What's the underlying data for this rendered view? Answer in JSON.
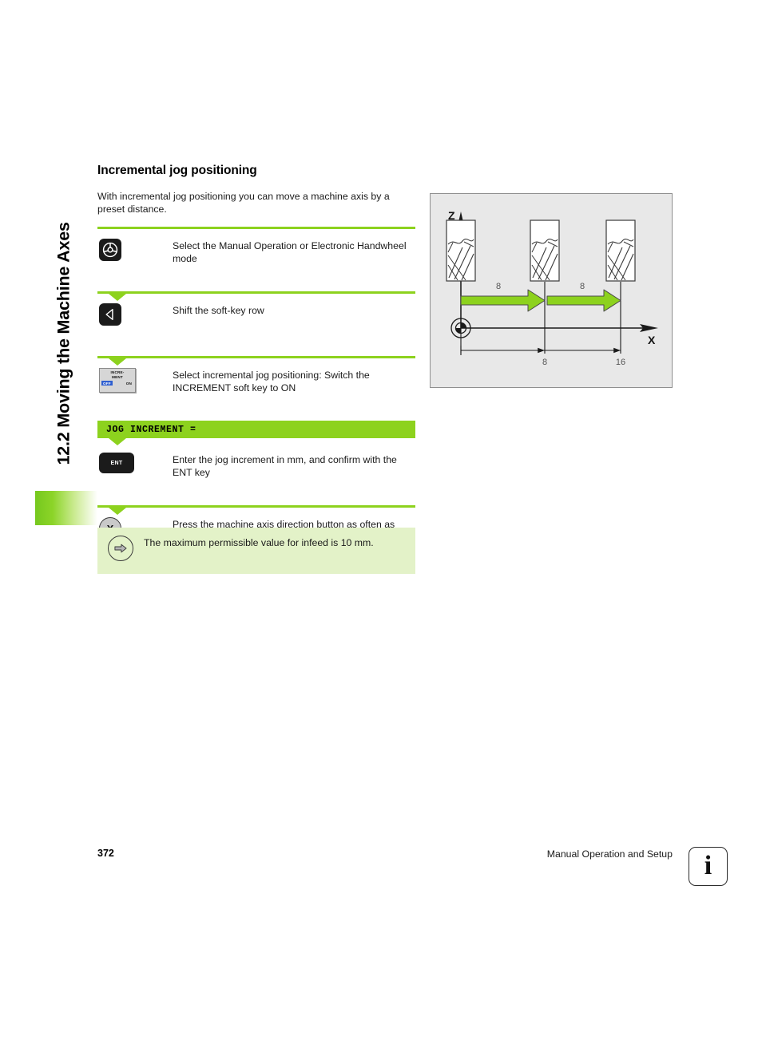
{
  "sidebar": {
    "section_title": "12.2 Moving the Machine Axes"
  },
  "main": {
    "heading": "Incremental jog positioning",
    "intro": "With incremental jog positioning you can move a machine axis by a preset distance.",
    "steps": [
      {
        "key_icon": "handwheel-mode-key",
        "key_label": "",
        "text": "Select the Manual Operation or Electronic Handwheel mode"
      },
      {
        "key_icon": "shift-softkey-row-key",
        "key_label": "",
        "text": "Shift the soft-key row"
      },
      {
        "key_icon": "increment-softkey",
        "key_label": "INCRE- MENT",
        "softkey_line1": "INCRE-",
        "softkey_line2": "MENT",
        "softkey_off": "OFF",
        "softkey_on": "ON",
        "text": "Select incremental jog positioning: Switch the INCREMENT soft key to ON"
      },
      {
        "key_icon": "ent-key",
        "key_label": "ENT",
        "text": "Enter the jog increment in mm, and confirm with the ENT key"
      },
      {
        "key_icon": "axis-direction-button-x",
        "key_label": "X",
        "text": "Press the machine axis direction button as often as desired"
      }
    ],
    "prompt_bar": "JOG INCREMENT =",
    "note": "The maximum permissible value for infeed is 10 mm."
  },
  "figure": {
    "axis_z_label": "Z",
    "axis_x_label": "X",
    "arrow_labels": [
      "8",
      "8"
    ],
    "dimension_labels": [
      "8",
      "16"
    ],
    "tool_count": 3
  },
  "footer": {
    "page_number": "372",
    "chapter_title": "Manual Operation and Setup",
    "info_glyph": "i"
  },
  "colors": {
    "accent_green": "#8dd21e",
    "note_green": "#e3f2c8",
    "tab_green": "#76c81e",
    "key_black": "#1b1b1b",
    "softkey_blue": "#2f5fd0",
    "figure_bg": "#e8e8e8"
  }
}
